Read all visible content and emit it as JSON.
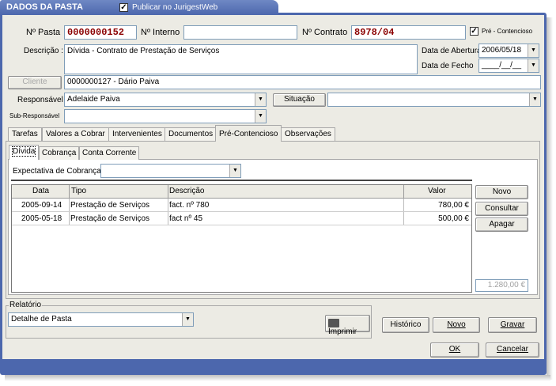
{
  "window": {
    "title": "DADOS DA PASTA",
    "publish_label": "Publicar no JurigestWeb",
    "publish_checked": true
  },
  "header": {
    "pasta_label": "Nº Pasta",
    "pasta_value": "0000000152",
    "interno_label": "Nº Interno",
    "interno_value": "",
    "contrato_label": "Nº Contrato",
    "contrato_value": "8978/04",
    "pre_contencioso_label": "Pré - Contencioso",
    "pre_contencioso_checked": true
  },
  "descricao": {
    "label": "Descrição :",
    "value": "Dívida - Contrato de Prestação de Serviços"
  },
  "datas": {
    "abertura_label": "Data de Abertura",
    "abertura_value": "2006/05/18",
    "fecho_label": "Data de Fecho",
    "fecho_value": "____/__/__"
  },
  "cliente": {
    "button_label": "Cliente",
    "value": "0000000127 - Dário Paiva"
  },
  "responsavel": {
    "label": "Responsável",
    "value": "Adelaide Paiva",
    "sub_label": "Sub-Responsável",
    "sub_value": ""
  },
  "situacao": {
    "button_label": "Situação",
    "value": ""
  },
  "tabs": [
    {
      "label": "Tarefas"
    },
    {
      "label": "Valores a Cobrar"
    },
    {
      "label": "Intervenientes"
    },
    {
      "label": "Documentos"
    },
    {
      "label": "Pré-Contencioso"
    },
    {
      "label": "Observações"
    }
  ],
  "subtabs": [
    {
      "label": "Dívida"
    },
    {
      "label": "Cobrança"
    },
    {
      "label": "Conta Corrente"
    }
  ],
  "expectativa": {
    "label": "Expectativa de Cobrança",
    "value": ""
  },
  "table": {
    "columns": [
      "Data",
      "Tipo",
      "Descrição",
      "Valor"
    ],
    "rows": [
      {
        "data": "2005-09-14",
        "tipo": "Prestação de Serviços",
        "descricao": "fact. nº 780",
        "valor": "780,00 €"
      },
      {
        "data": "2005-05-18",
        "tipo": "Prestação de Serviços",
        "descricao": "fact nº 45",
        "valor": "500,00 €"
      }
    ],
    "total": "1.280,00 €"
  },
  "side_buttons": {
    "novo": "Novo",
    "consultar": "Consultar",
    "apagar": "Apagar"
  },
  "relatorio": {
    "label": "Relatório",
    "value": "Detalhe de Pasta",
    "imprimir": "Imprimir"
  },
  "footer_buttons": {
    "historico": "Histórico",
    "novo": "Novo",
    "gravar": "Gravar",
    "ok": "OK",
    "cancelar": "Cancelar"
  }
}
